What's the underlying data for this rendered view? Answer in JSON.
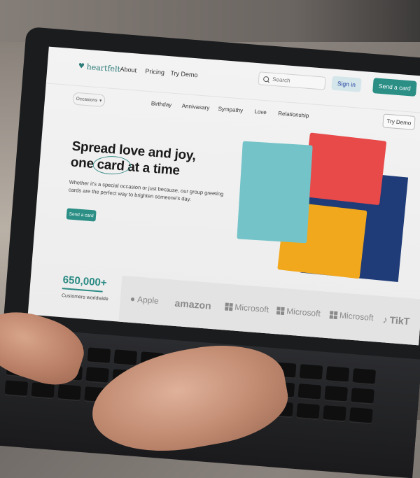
{
  "nav": {
    "logo_text": "heartfelt",
    "links": [
      "About",
      "Pricing",
      "Try Demo"
    ],
    "search_placeholder": "Search",
    "signin_label": "Sign in",
    "send_label": "Send a card"
  },
  "subnav": {
    "occasions_label": "Occasions",
    "items": [
      "Birthday",
      "Annivasary",
      "Sympathy",
      "Love",
      "Relationship"
    ],
    "try_demo_label": "Try Demo"
  },
  "hero": {
    "line1": "Spread love and joy,",
    "line2_a": "one ",
    "line2_b": "card",
    "line2_c": " at a time",
    "description": "Whether it's a special occasion or just because, our group greeting cards are the perfect way to brighten someone's day.",
    "cta_label": "Send a card"
  },
  "cards_colors": {
    "red": "#e84a4a",
    "navy": "#1f3b78",
    "teal": "#74c3c8",
    "yellow": "#f2a81d"
  },
  "stats": {
    "value": "650,000+",
    "label": "Customers worldwide"
  },
  "brands": [
    "Apple",
    "amazon",
    "Microsoft",
    "Microsoft",
    "Microsoft",
    "TikT"
  ],
  "colors": {
    "accent": "#2b8f86",
    "signin_bg": "#d4e6ea",
    "signin_text": "#1f3fa0"
  }
}
